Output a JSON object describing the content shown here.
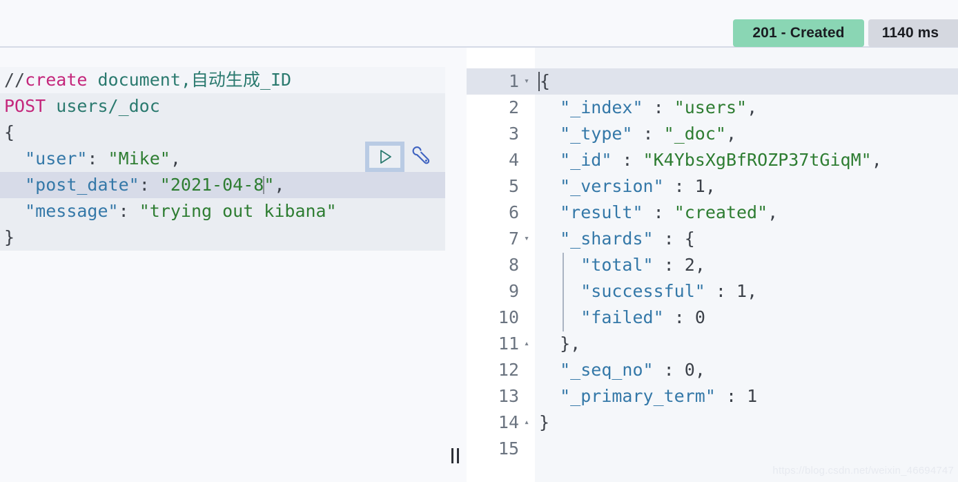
{
  "header": {
    "status_badge": "201 - Created",
    "time_badge": "1140 ms",
    "status_color": "#8ad6b4",
    "time_color": "#d5d8e0"
  },
  "request": {
    "comment": {
      "slashes": "//",
      "keyword": "create",
      "rest": " document,自动生成_ID"
    },
    "method": "POST",
    "path": " users/_doc",
    "open_brace": "{",
    "close_brace": "}",
    "body": [
      {
        "key": "\"user\"",
        "sep": ": ",
        "value": "\"Mike\"",
        "trail": ","
      },
      {
        "key": "\"post_date\"",
        "sep": ": ",
        "value": "\"2021-04-8",
        "value_end": "\"",
        "trail": ","
      },
      {
        "key": "\"message\"",
        "sep": ": ",
        "value": "\"trying out kibana\"",
        "trail": ""
      }
    ],
    "actions": {
      "play": "play-icon",
      "wrench": "wrench-icon"
    }
  },
  "response": {
    "lines": [
      {
        "num": "1",
        "fold": "▾",
        "text": "{",
        "active": true
      },
      {
        "num": "2",
        "fold": "",
        "text": "  \"_index\" : \"users\","
      },
      {
        "num": "3",
        "fold": "",
        "text": "  \"_type\" : \"_doc\","
      },
      {
        "num": "4",
        "fold": "",
        "text": "  \"_id\" : \"K4YbsXgBfROZP37tGiqM\","
      },
      {
        "num": "5",
        "fold": "",
        "text": "  \"_version\" : 1,"
      },
      {
        "num": "6",
        "fold": "",
        "text": "  \"result\" : \"created\","
      },
      {
        "num": "7",
        "fold": "▾",
        "text": "  \"_shards\" : {"
      },
      {
        "num": "8",
        "fold": "",
        "text": "    \"total\" : 2,"
      },
      {
        "num": "9",
        "fold": "",
        "text": "    \"successful\" : 1,"
      },
      {
        "num": "10",
        "fold": "",
        "text": "    \"failed\" : 0"
      },
      {
        "num": "11",
        "fold": "▴",
        "text": "  },"
      },
      {
        "num": "12",
        "fold": "",
        "text": "  \"_seq_no\" : 0,"
      },
      {
        "num": "13",
        "fold": "",
        "text": "  \"_primary_term\" : 1"
      },
      {
        "num": "14",
        "fold": "▴",
        "text": "}"
      },
      {
        "num": "15",
        "fold": "",
        "text": ""
      }
    ]
  },
  "splitter": {
    "handle": "drag-handle"
  },
  "watermark": "https://blog.csdn.net/weixin_46694747"
}
